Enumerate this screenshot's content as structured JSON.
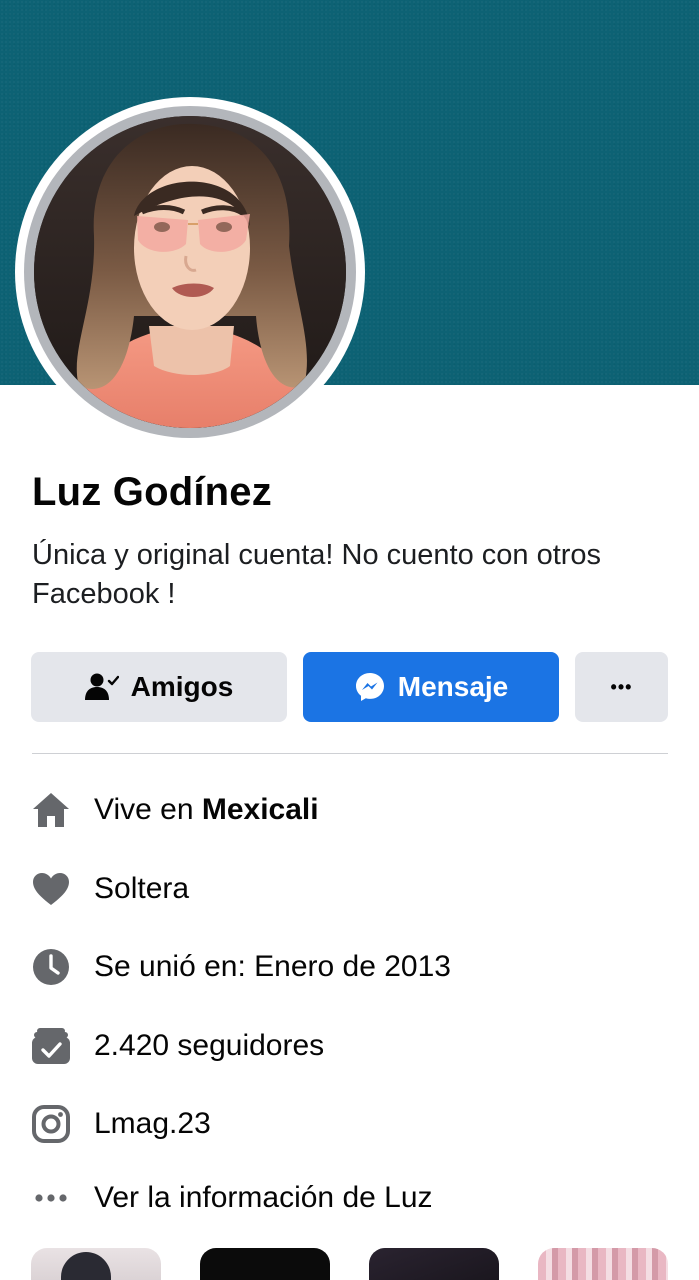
{
  "profile": {
    "name": "Luz Godínez",
    "bio": "Única y original cuenta! No cuento con otros Facebook !"
  },
  "actions": {
    "friends_label": "Amigos",
    "message_label": "Mensaje",
    "more_label": "•••"
  },
  "intro": {
    "lives_prefix": "Vive en ",
    "lives_city": "Mexicali",
    "relationship": "Soltera",
    "joined": "Se unió en: Enero de 2013",
    "followers": "2.420 seguidores",
    "instagram": "Lmag.23",
    "see_info": "Ver la información de Luz"
  },
  "colors": {
    "cover": "#0d6274",
    "primary_button": "#1b74e4",
    "secondary_button": "#e4e6eb",
    "icon_gray": "#65676b"
  },
  "icons": {
    "lives": "home-icon",
    "relationship": "heart-icon",
    "joined": "clock-icon",
    "followers": "followers-icon",
    "instagram": "instagram-icon",
    "see_info": "more-dots-icon"
  }
}
